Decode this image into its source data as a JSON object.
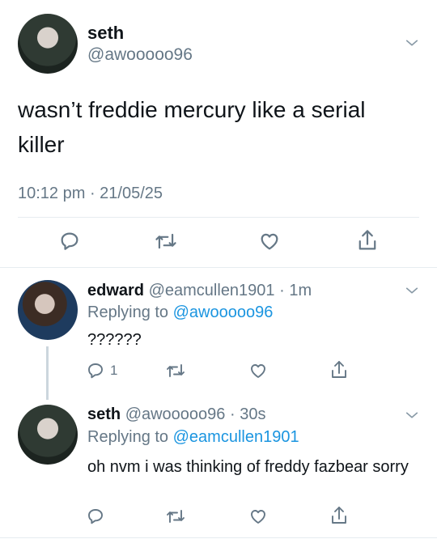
{
  "main_tweet": {
    "display_name": "seth",
    "handle": "@awooooo96",
    "text": "wasn’t freddie mercury like a serial killer",
    "timestamp": "10:12 pm · 21/05/25",
    "actions": {
      "reply_icon": "reply-icon",
      "retweet_icon": "retweet-icon",
      "like_icon": "heart-icon",
      "share_icon": "share-icon"
    }
  },
  "replies": [
    {
      "display_name": "edward",
      "handle_time": "@eamcullen1901 · 1m",
      "replying_prefix": "Replying to",
      "replying_to": "@awooooo96",
      "text": "??????",
      "reply_count": "1"
    },
    {
      "display_name": "seth",
      "handle_time": "@awooooo96 · 30s",
      "replying_prefix": "Replying to",
      "replying_to": "@eamcullen1901",
      "text": "oh nvm i was thinking of freddy fazbear sorry",
      "reply_count": ""
    }
  ],
  "colors": {
    "link": "#1b95e0",
    "muted": "#657786",
    "divider": "#e6ecf0"
  }
}
